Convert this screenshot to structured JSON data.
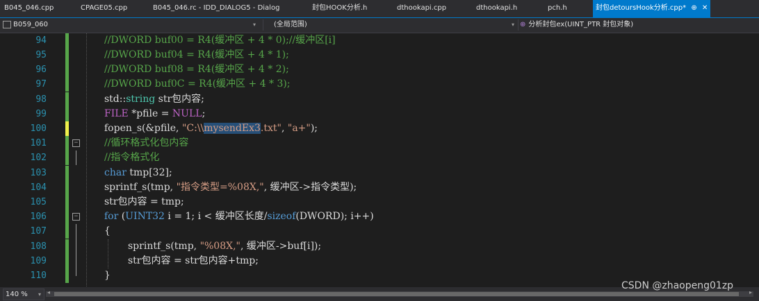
{
  "tabs": [
    {
      "label": "B045_046.cpp"
    },
    {
      "label": "CPAGE05.cpp"
    },
    {
      "label": "B045_046.rc - IDD_DIALOG5 - Dialog"
    },
    {
      "label": "封包HOOK分析.h"
    },
    {
      "label": "dthookapi.cpp"
    },
    {
      "label": "dthookapi.h"
    },
    {
      "label": "pch.h"
    },
    {
      "label": "封包detoursHook分析.cpp*",
      "pin": "⊕",
      "close": "✕"
    }
  ],
  "nav": {
    "project": "B059_060",
    "scope": "(全局范围)",
    "function": "分析封包ex(UINT_PTR 封包对象)"
  },
  "lines": [
    {
      "num": "94",
      "code": "//DWORD buf00 = R4(缓冲区 + 4 * 0);//缓冲区[i]"
    },
    {
      "num": "95",
      "code": "//DWORD buf04 = R4(缓冲区 + 4 * 1);"
    },
    {
      "num": "96",
      "code": "//DWORD buf08 = R4(缓冲区 + 4 * 2);"
    },
    {
      "num": "97",
      "code": "//DWORD buf0C = R4(缓冲区 + 4 * 3);"
    },
    {
      "num": "98",
      "p1": "std::",
      "p2": "string",
      "p3": " str包内容;"
    },
    {
      "num": "99",
      "p1": "FILE",
      "p2": " *pfile = ",
      "p3": "NULL",
      "p4": ";"
    },
    {
      "num": "100",
      "p1": "fopen_s(&pfile, ",
      "p2": "\"C:\\\\",
      "p3": "mysendEx3",
      "p4": ".txt\"",
      "p5": ", ",
      "p6": "\"a+\"",
      "p7": ");"
    },
    {
      "num": "101",
      "code": "//循环格式化包内容"
    },
    {
      "num": "102",
      "code": "//指令格式化"
    },
    {
      "num": "103",
      "p1": "char",
      "p2": " tmp[32];"
    },
    {
      "num": "104",
      "p1": "sprintf_s(tmp, ",
      "p2": "\"指令类型=%08X,\"",
      "p3": ", 缓冲区->指令类型);"
    },
    {
      "num": "105",
      "code": "str包内容 = tmp;"
    },
    {
      "num": "106",
      "p1": "for",
      "p2": " (",
      "p3": "UINT32",
      "p4": " i = 1; i < 缓冲区长度/",
      "p5": "sizeof",
      "p6": "(DWORD); i++)"
    },
    {
      "num": "107",
      "code": "{"
    },
    {
      "num": "108",
      "p1": "sprintf_s(tmp, ",
      "p2": "\"%08X,\"",
      "p3": ", 缓冲区->buf[i]);"
    },
    {
      "num": "109",
      "code": "str包内容 = str包内容+tmp;"
    },
    {
      "num": "110",
      "code": "}"
    }
  ],
  "status": {
    "zoom": "140 %"
  },
  "watermark": "CSDN @zhaopeng01zp",
  "colors": {
    "background": "#1e1e1e",
    "accent": "#007acc",
    "comment": "#57a64a",
    "keyword": "#569cd6",
    "string": "#d69d85",
    "macro": "#bd63c5",
    "type": "#4ec9b0",
    "line_number": "#2b91af"
  }
}
